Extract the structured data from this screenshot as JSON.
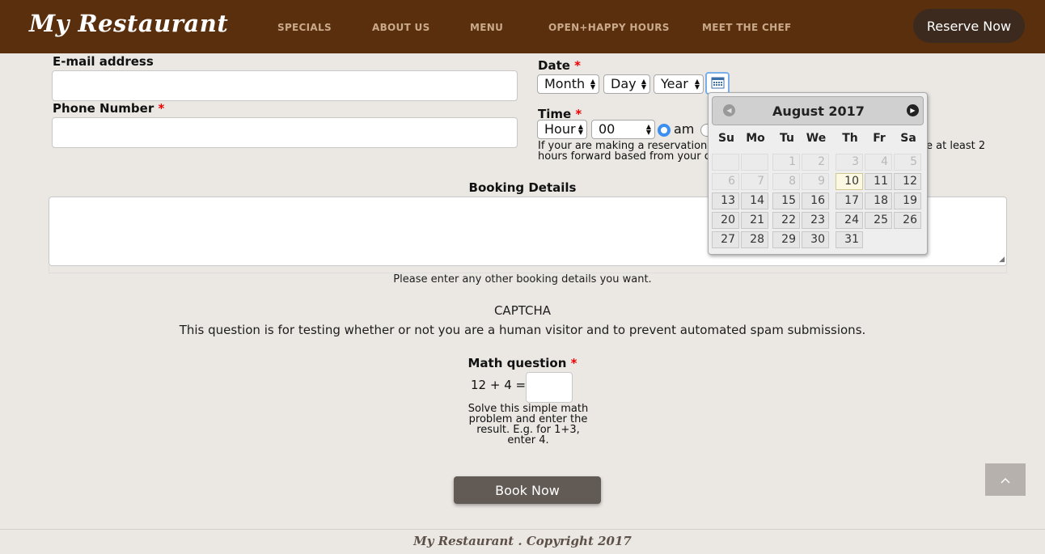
{
  "header": {
    "logo": "My Restaurant",
    "nav": [
      "SPECIALS",
      "ABOUT US",
      "MENU",
      "OPEN+HAPPY HOURS",
      "MEET THE CHEF"
    ],
    "reserve_label": "Reserve Now"
  },
  "form": {
    "email_label": "E-mail address",
    "phone_label": "Phone Number",
    "date_label": "Date",
    "time_label": "Time",
    "required_mark": "*",
    "month_select": "Month",
    "day_select": "Day",
    "year_select": "Year",
    "hour_select": "Hour",
    "minute_select": "00",
    "ampm_option": "am",
    "time_hint_line1_left": "If your are making a reservation",
    "time_hint_line1_right": "e at least 2",
    "time_hint_line2": "hours forward based from your c",
    "booking_details_label": "Booking Details",
    "booking_details_help": "Please enter any other booking details you want.",
    "captcha_title": "CAPTCHA",
    "captcha_desc": "This question is for testing whether or not you are a human visitor and to prevent automated spam submissions.",
    "math_label": "Math question",
    "math_question": "12 + 4 =",
    "math_help": "Solve this simple math problem and enter the result. E.g. for 1+3, enter 4.",
    "book_label": "Book Now"
  },
  "datepicker": {
    "title": "August 2017",
    "prev_icon": "chevron-left-icon",
    "next_icon": "chevron-right-icon",
    "weekdays": [
      "Su",
      "Mo",
      "Tu",
      "We",
      "Th",
      "Fr",
      "Sa"
    ],
    "today": "10",
    "weeks": [
      [
        "",
        "",
        "",
        "1",
        "2",
        "3",
        "4",
        "5"
      ],
      [
        "6",
        "7",
        "8",
        "9",
        "10",
        "11",
        "12"
      ],
      [
        "13",
        "14",
        "15",
        "16",
        "17",
        "18",
        "19"
      ],
      [
        "20",
        "21",
        "22",
        "23",
        "24",
        "25",
        "26"
      ],
      [
        "27",
        "28",
        "29",
        "30",
        "31"
      ]
    ]
  },
  "footer": {
    "text": "My Restaurant . Copyright 2017"
  },
  "colors": {
    "header_bg": "#5a2f0e",
    "page_bg": "#ebe8e4",
    "nav_text": "#c9a98a",
    "button_bg": "#625a55",
    "required": "#ee0000"
  }
}
